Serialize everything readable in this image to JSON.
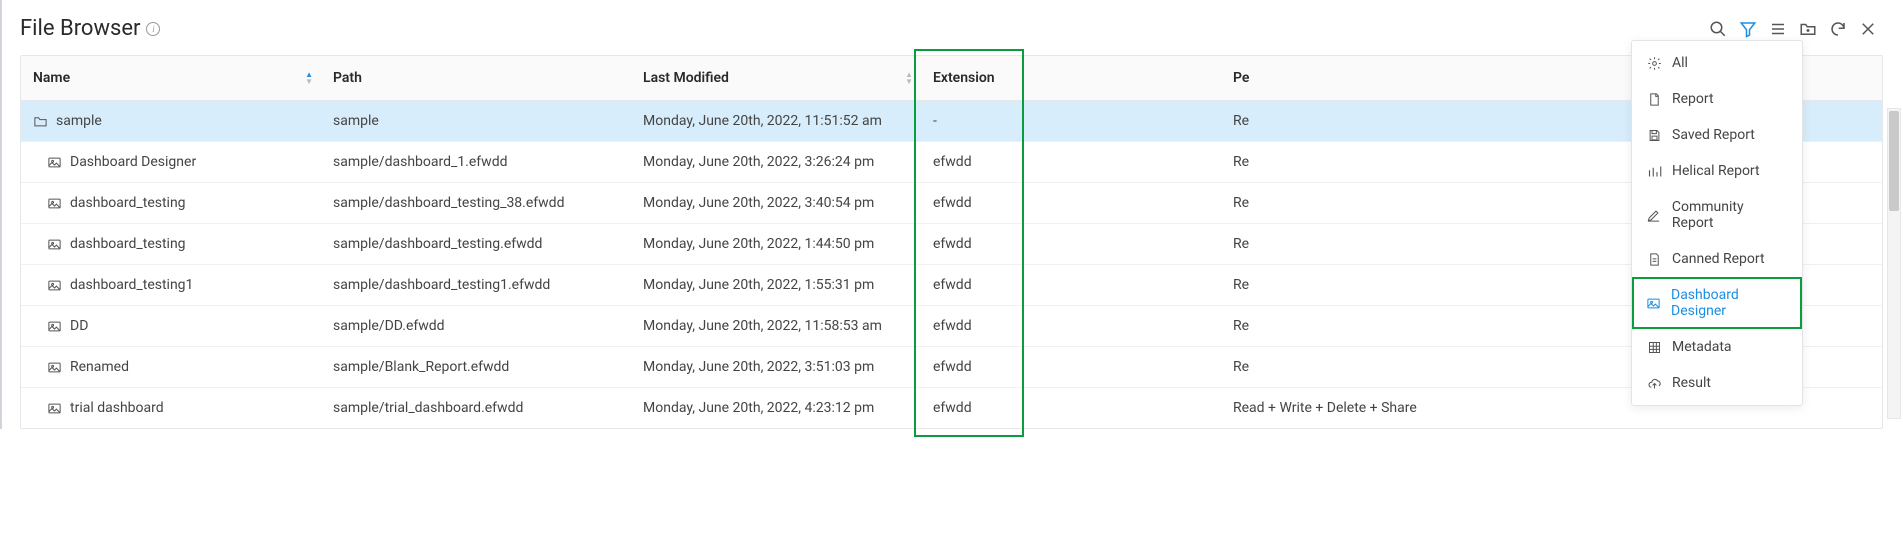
{
  "page": {
    "title": "File Browser"
  },
  "columns": {
    "name": "Name",
    "path": "Path",
    "modified": "Last Modified",
    "extension": "Extension",
    "permissions_prefix": "Pe"
  },
  "rows": [
    {
      "type": "folder",
      "name": "sample",
      "path": "sample",
      "modified": "Monday, June 20th, 2022, 11:51:52 am",
      "extension": "-",
      "perm": "Re",
      "selected": true
    },
    {
      "type": "file",
      "name": "Dashboard Designer",
      "path": "sample/dashboard_1.efwdd",
      "modified": "Monday, June 20th, 2022, 3:26:24 pm",
      "extension": "efwdd",
      "perm": "Re"
    },
    {
      "type": "file",
      "name": "dashboard_testing",
      "path": "sample/dashboard_testing_38.efwdd",
      "modified": "Monday, June 20th, 2022, 3:40:54 pm",
      "extension": "efwdd",
      "perm": "Re"
    },
    {
      "type": "file",
      "name": "dashboard_testing",
      "path": "sample/dashboard_testing.efwdd",
      "modified": "Monday, June 20th, 2022, 1:44:50 pm",
      "extension": "efwdd",
      "perm": "Re"
    },
    {
      "type": "file",
      "name": "dashboard_testing1",
      "path": "sample/dashboard_testing1.efwdd",
      "modified": "Monday, June 20th, 2022, 1:55:31 pm",
      "extension": "efwdd",
      "perm": "Re"
    },
    {
      "type": "file",
      "name": "DD",
      "path": "sample/DD.efwdd",
      "modified": "Monday, June 20th, 2022, 11:58:53 am",
      "extension": "efwdd",
      "perm": "Re"
    },
    {
      "type": "file",
      "name": "Renamed",
      "path": "sample/Blank_Report.efwdd",
      "modified": "Monday, June 20th, 2022, 3:51:03 pm",
      "extension": "efwdd",
      "perm": "Re"
    },
    {
      "type": "file",
      "name": "trial dashboard",
      "path": "sample/trial_dashboard.efwdd",
      "modified": "Monday, June 20th, 2022, 4:23:12 pm",
      "extension": "efwdd",
      "perm": "Read + Write + Delete + Share"
    }
  ],
  "dropdown": {
    "items": [
      {
        "icon": "gear",
        "label": "All"
      },
      {
        "icon": "doc",
        "label": "Report"
      },
      {
        "icon": "save",
        "label": "Saved Report"
      },
      {
        "icon": "chart",
        "label": "Helical Report"
      },
      {
        "icon": "pen",
        "label": "Community Report"
      },
      {
        "icon": "doc2",
        "label": "Canned Report"
      },
      {
        "icon": "image",
        "label": "Dashboard Designer",
        "selected": true
      },
      {
        "icon": "grid",
        "label": "Metadata"
      },
      {
        "icon": "cloud",
        "label": "Result"
      }
    ]
  }
}
